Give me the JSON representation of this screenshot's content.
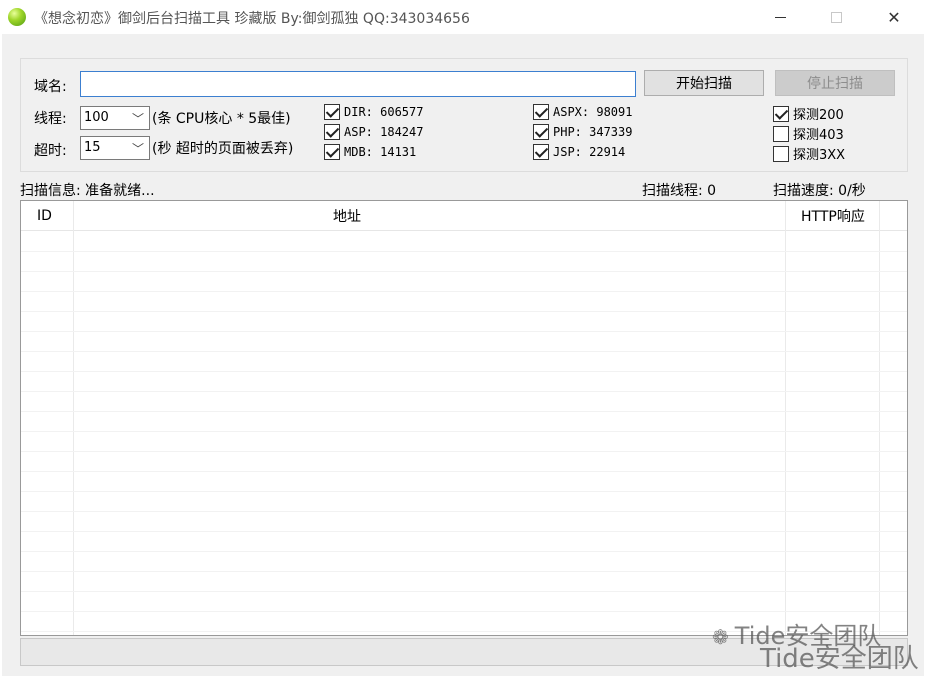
{
  "window": {
    "title": "《想念初恋》御剑后台扫描工具 珍藏版 By:御剑孤独 QQ:343034656",
    "min_icon": "minimize-icon",
    "max_icon": "maximize-icon",
    "close_icon": "close-icon",
    "close_glyph": "✕"
  },
  "form": {
    "domain_label": "域名:",
    "domain_value": "",
    "start_button": "开始扫描",
    "stop_button": "停止扫描",
    "threads_label": "线程:",
    "threads_value": "100",
    "threads_hint": "(条 CPU核心 * 5最佳)",
    "timeout_label": "超时:",
    "timeout_value": "15",
    "timeout_hint": "(秒 超时的页面被丢弃)",
    "chevron": "﹀"
  },
  "dictionaries": [
    {
      "label": "DIR: 606577",
      "checked": true
    },
    {
      "label": "ASP: 184247",
      "checked": true
    },
    {
      "label": "MDB: 14131",
      "checked": true
    },
    {
      "label": "ASPX: 98091",
      "checked": true
    },
    {
      "label": "PHP: 347339",
      "checked": true
    },
    {
      "label": "JSP: 22914",
      "checked": true
    }
  ],
  "probes": [
    {
      "label": "探测200",
      "checked": true
    },
    {
      "label": "探测403",
      "checked": false
    },
    {
      "label": "探测3XX",
      "checked": false
    }
  ],
  "status": {
    "info": "扫描信息: 准备就绪...",
    "threads": "扫描线程: 0",
    "speed": "扫描速度: 0/秒"
  },
  "table": {
    "columns": [
      "ID",
      "地址",
      "HTTP响应"
    ],
    "rows": []
  },
  "watermark": {
    "text": "Tide安全团队"
  }
}
